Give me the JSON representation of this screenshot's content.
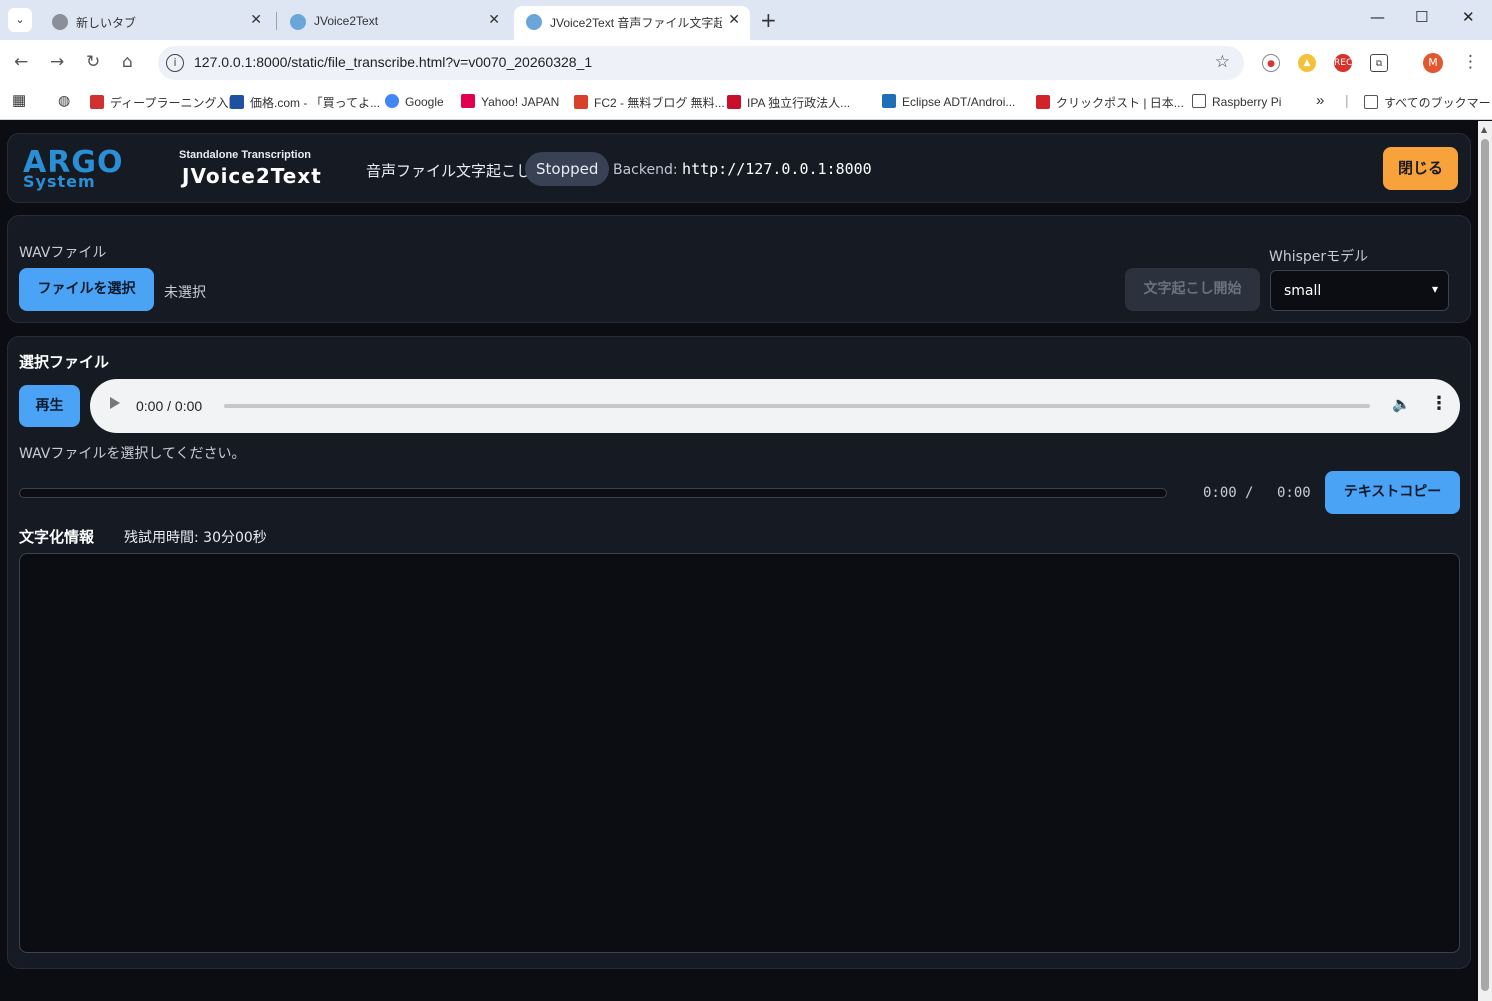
{
  "browser": {
    "tabs": [
      {
        "title": "新しいタブ"
      },
      {
        "title": "JVoice2Text"
      },
      {
        "title": "JVoice2Text 音声ファイル文字起こ"
      }
    ],
    "url": "127.0.0.1:8000/static/file_transcribe.html?v=v0070_20260328_1",
    "profile_initial": "M",
    "bookmarks": [
      {
        "label": "ディープラーニング入門"
      },
      {
        "label": "価格.com - 「買ってよ..."
      },
      {
        "label": "Google"
      },
      {
        "label": "Yahoo! JAPAN"
      },
      {
        "label": "FC2 - 無料ブログ 無料..."
      },
      {
        "label": "IPA 独立行政法人..."
      },
      {
        "label": "Eclipse ADT/Androi..."
      },
      {
        "label": "クリックポスト | 日本..."
      },
      {
        "label": "Raspberry Pi"
      },
      {
        "label": "すべてのブックマーク"
      }
    ]
  },
  "header": {
    "logo_line1": "ARGO",
    "logo_line2": "System",
    "subtitle": "Standalone Transcription",
    "app_title": "JVoice2Text",
    "page_title": "音声ファイル文字起こし",
    "status": "Stopped",
    "backend_label": "Backend:",
    "backend_url": "http://127.0.0.1:8000",
    "close_label": "閉じる"
  },
  "file_panel": {
    "wav_label": "WAVファイル",
    "choose_file_label": "ファイルを選択",
    "no_file_text": "未選択",
    "start_label": "文字起こし開始",
    "model_label": "Whisperモデル",
    "model_value": "small"
  },
  "main": {
    "selected_title": "選択ファイル",
    "play_label": "再生",
    "audio_time": "0:00 / 0:00",
    "hint": "WAVファイルを選択してください。",
    "progress_fraction": 0,
    "time_current": "0:00",
    "time_sep": "/",
    "time_total": "0:00",
    "copy_label": "テキストコピー",
    "info_title": "文字化情報",
    "remaining": "残試用時間: 30分00秒",
    "transcript_text": ""
  }
}
